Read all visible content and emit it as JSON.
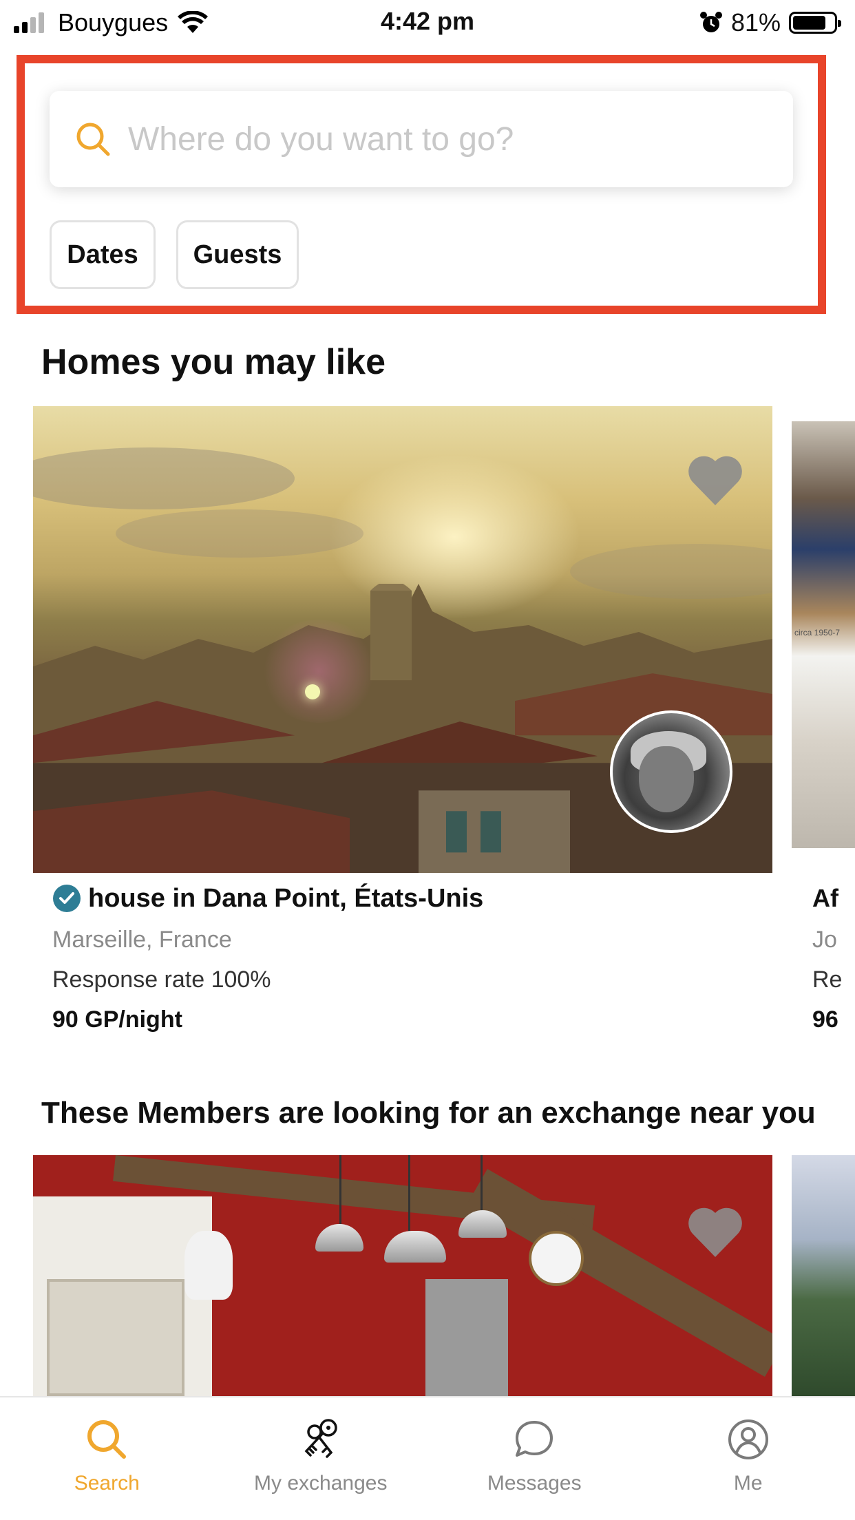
{
  "status_bar": {
    "carrier": "Bouygues",
    "time": "4:42 pm",
    "battery_percent": "81%",
    "battery_level": 0.81
  },
  "search": {
    "placeholder": "Where do you want to go?",
    "filters": [
      "Dates",
      "Guests"
    ]
  },
  "sections": {
    "homes_title": "Homes you may like",
    "members_title": "These Members are looking for an exchange near you"
  },
  "homes": [
    {
      "title": "house in Dana Point, États-Unis",
      "location": "Marseille, France",
      "response_rate": "Response rate 100%",
      "price": "90 GP/night",
      "verified": true
    }
  ],
  "peek_card": {
    "title": "Af",
    "location": "Jo",
    "response": "Re",
    "price": "96",
    "image_caption": "circa 1950-7"
  },
  "tabs": [
    {
      "label": "Search",
      "icon": "search-icon",
      "active": true
    },
    {
      "label": "My exchanges",
      "icon": "keys-icon",
      "active": false
    },
    {
      "label": "Messages",
      "icon": "chat-bubble-icon",
      "active": false
    },
    {
      "label": "Me",
      "icon": "profile-icon",
      "active": false
    }
  ],
  "colors": {
    "accent": "#f0a72e",
    "highlight": "#e8442a",
    "verified": "#2e7d95"
  }
}
